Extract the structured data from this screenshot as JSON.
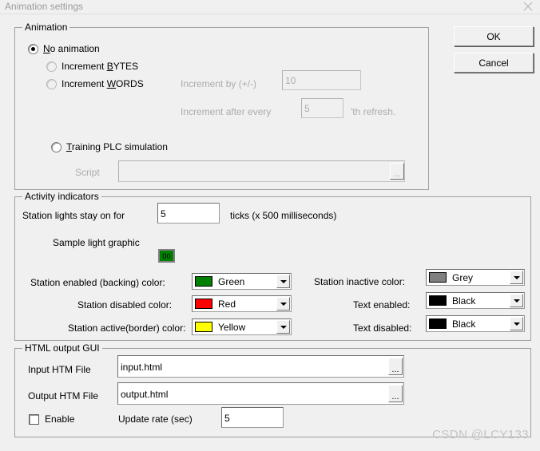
{
  "window": {
    "title": "Animation settings",
    "close_icon": "close-icon"
  },
  "buttons": {
    "ok": "OK",
    "cancel": "Cancel"
  },
  "animation_group": {
    "title": "Animation",
    "options": [
      {
        "label_pre": "",
        "accel": "N",
        "label_post": "o animation",
        "selected": true,
        "disabled": false
      },
      {
        "label_pre": "Increment ",
        "accel": "B",
        "label_post": "YTES",
        "selected": false,
        "disabled": true
      },
      {
        "label_pre": "Increment ",
        "accel": "W",
        "label_post": "ORDS",
        "selected": false,
        "disabled": true
      },
      {
        "label_pre": "",
        "accel": "T",
        "label_post": "raining PLC simulation",
        "selected": false,
        "disabled": false
      }
    ],
    "increment_by_label": "Increment by (+/-)",
    "increment_by_value": "10",
    "increment_after_label": "Increment after every",
    "increment_after_value": "5",
    "refresh_suffix": "'th refresh.",
    "script_label": "Script",
    "script_value": "",
    "browse_label": "..."
  },
  "activity_group": {
    "title": "Activity indicators",
    "lights_label": "Station lights stay on for",
    "lights_value": "5",
    "ticks_label": "ticks (x 500 milliseconds)",
    "sample_label": "Sample light graphic",
    "sample_text": "00",
    "sample_color": "#008000",
    "colors_left": [
      {
        "label": "Station enabled (backing) color:",
        "value": "Green",
        "hex": "#008000"
      },
      {
        "label": "Station disabled color:",
        "value": "Red",
        "hex": "#ff0000"
      },
      {
        "label": "Station active(border) color:",
        "value": "Yellow",
        "hex": "#ffff00"
      }
    ],
    "colors_right": [
      {
        "label": "Station inactive color:",
        "value": "Grey",
        "hex": "#808080"
      },
      {
        "label": "Text enabled:",
        "value": "Black",
        "hex": "#000000"
      },
      {
        "label": "Text disabled:",
        "value": "Black",
        "hex": "#000000"
      }
    ]
  },
  "html_group": {
    "title": "HTML output GUI",
    "input_label": "Input HTM File",
    "input_value": "input.html",
    "output_label": "Output HTM File",
    "output_value": "output.html",
    "browse_label": "...",
    "enable_label": "Enable",
    "enable_checked": false,
    "update_rate_label": "Update rate (sec)",
    "update_rate_value": "5"
  },
  "watermark": "CSDN @LCY133"
}
